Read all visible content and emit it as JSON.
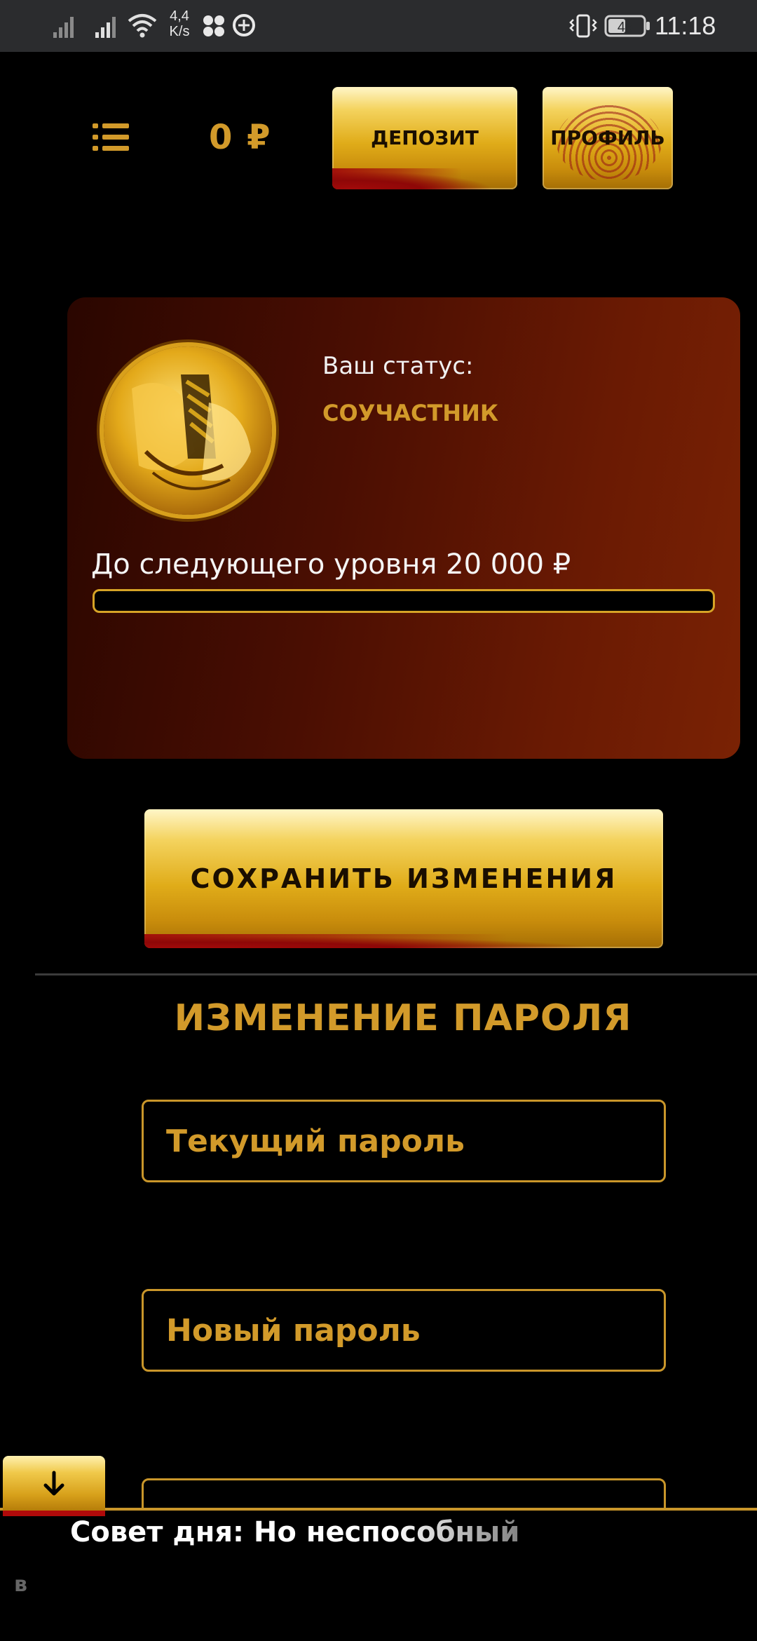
{
  "statusbar": {
    "speed_value": "4,4",
    "speed_unit": "K/s",
    "battery": "46",
    "time": "11:18"
  },
  "header": {
    "balance": "0 ₽",
    "deposit_label": "ДЕПОЗИТ",
    "profile_label": "ПРОФИЛЬ"
  },
  "status_card": {
    "status_label": "Ваш статус:",
    "status_value": "СОУЧАСТНИК",
    "next_level_text": "До следующего уровня 20 000 ₽",
    "progress_fraction": 0
  },
  "save_button_label": "СОХРАНИТЬ ИЗМЕНЕНИЯ",
  "password_section": {
    "title": "ИЗМЕНЕНИЕ ПАРОЛЯ",
    "current_placeholder": "Текущий пароль",
    "new_placeholder": "Новый пароль",
    "confirm_placeholder": ""
  },
  "tip": {
    "text": "Совет дня: Но неспособный",
    "second_line_start": "в"
  },
  "colors": {
    "gold": "#d29a2a",
    "card_dark": "#2a0600",
    "card_light": "#7a2204",
    "blood_red": "#a30a0a"
  }
}
